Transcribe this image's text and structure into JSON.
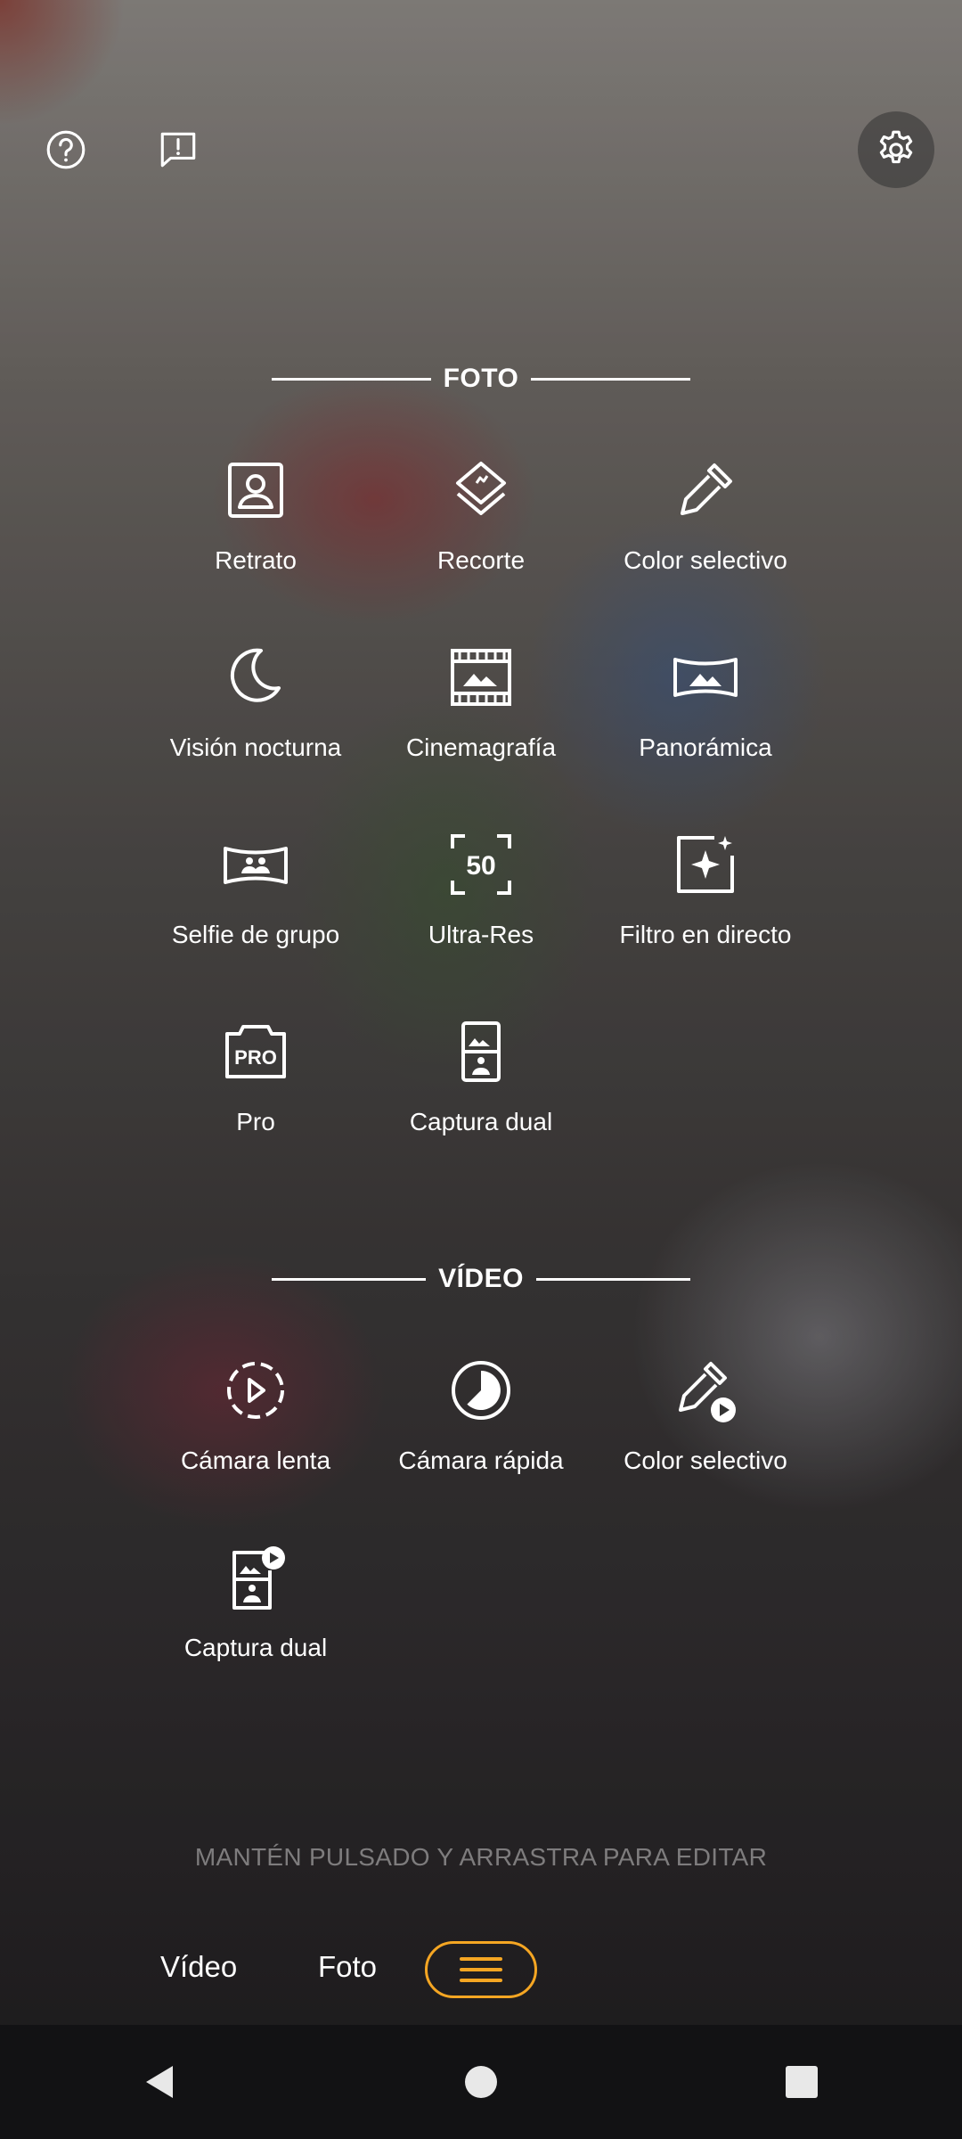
{
  "top_bar": {
    "help_icon": "help-circle-icon",
    "feedback_icon": "feedback-icon",
    "settings_icon": "gear-icon"
  },
  "photo_section": {
    "title": "FOTO",
    "modes": [
      {
        "label": "Retrato",
        "icon": "portrait-icon"
      },
      {
        "label": "Recorte",
        "icon": "cutout-icon"
      },
      {
        "label": "Color selectivo",
        "icon": "color-picker-icon"
      },
      {
        "label": "Visión nocturna",
        "icon": "moon-icon"
      },
      {
        "label": "Cinemagrafía",
        "icon": "film-icon"
      },
      {
        "label": "Panorámica",
        "icon": "panorama-icon"
      },
      {
        "label": "Selfie de grupo",
        "icon": "group-selfie-icon"
      },
      {
        "label": "Ultra-Res",
        "icon": "ultra-res-icon"
      },
      {
        "label": "Filtro en directo",
        "icon": "live-filter-icon"
      },
      {
        "label": "Pro",
        "icon": "pro-icon"
      },
      {
        "label": "Captura dual",
        "icon": "dual-capture-icon"
      }
    ]
  },
  "video_section": {
    "title": "VÍDEO",
    "modes": [
      {
        "label": "Cámara lenta",
        "icon": "slow-motion-icon"
      },
      {
        "label": "Cámara rápida",
        "icon": "timelapse-icon"
      },
      {
        "label": "Color selectivo",
        "icon": "color-picker-video-icon"
      },
      {
        "label": "Captura dual",
        "icon": "dual-capture-video-icon"
      }
    ]
  },
  "hint": "MANTÉN PULSADO Y ARRASTRA PARA EDITAR",
  "mode_switcher": {
    "tabs": [
      {
        "label": "Vídeo"
      },
      {
        "label": "Foto"
      }
    ],
    "active": "menu",
    "accent_color": "#f5a623"
  },
  "nav_bar": {
    "back_icon": "back-triangle-icon",
    "home_icon": "home-circle-icon",
    "recents_icon": "recents-square-icon"
  }
}
